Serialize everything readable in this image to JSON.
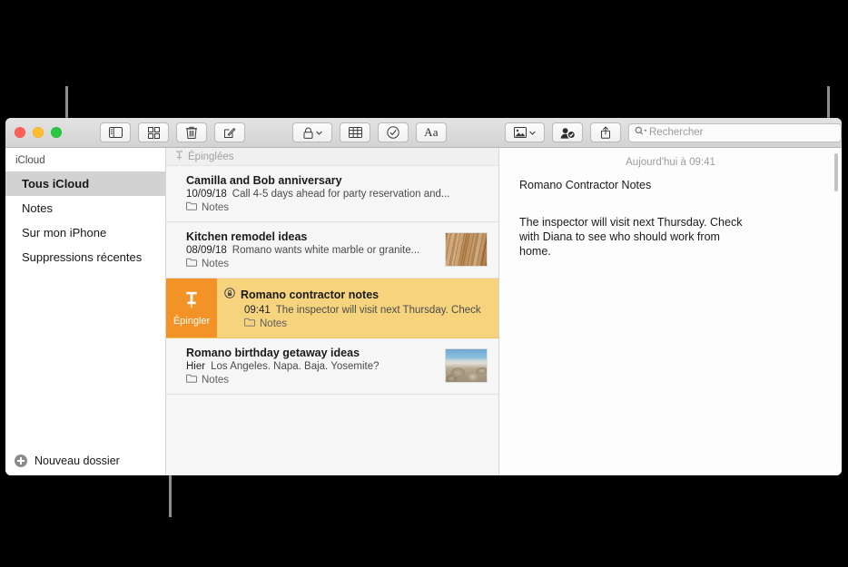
{
  "window": {
    "traffic_lights": [
      "close",
      "minimize",
      "zoom"
    ],
    "colors": {
      "pin_accent": "#f29227",
      "pinned_row": "#f6d47e",
      "selection": "#d2d2d2",
      "close": "#ff5f57",
      "minimize": "#ffbd2e",
      "zoom": "#28c840"
    }
  },
  "toolbar": {
    "left_buttons": [
      {
        "name": "sidebar-toggle",
        "icon": "sidebar-icon",
        "label": ""
      },
      {
        "name": "gallery-view",
        "icon": "grid-icon",
        "label": ""
      },
      {
        "name": "delete-note",
        "icon": "trash-icon",
        "label": ""
      },
      {
        "name": "new-note",
        "icon": "compose-icon",
        "label": ""
      }
    ],
    "center_buttons": [
      {
        "name": "lock-note",
        "icon": "lock-icon",
        "label": "",
        "has_menu": true
      },
      {
        "name": "add-table",
        "icon": "table-icon",
        "label": ""
      },
      {
        "name": "checklist",
        "icon": "checkmark-circle-icon",
        "label": ""
      },
      {
        "name": "format-text",
        "icon": "aa-icon",
        "label": "Aa"
      }
    ],
    "right_buttons": [
      {
        "name": "add-media",
        "icon": "photo-icon",
        "label": "",
        "has_menu": true
      },
      {
        "name": "add-collaborator",
        "icon": "person-add-icon",
        "label": ""
      },
      {
        "name": "share-note",
        "icon": "share-icon",
        "label": ""
      }
    ],
    "search": {
      "placeholder": "Rechercher",
      "value": "",
      "icon": "search-icon"
    }
  },
  "sidebar": {
    "header": "iCloud",
    "items": [
      {
        "label": "Tous iCloud",
        "selected": true
      },
      {
        "label": "Notes",
        "selected": false
      },
      {
        "label": "Sur mon iPhone",
        "selected": false
      },
      {
        "label": "Suppressions récentes",
        "selected": false
      }
    ],
    "footer": {
      "label": "Nouveau dossier",
      "icon": "plus-circle-icon"
    }
  },
  "note_list": {
    "section_header": {
      "label": "Épinglées",
      "icon": "pin-icon"
    },
    "notes": [
      {
        "title": "Camilla and Bob anniversary",
        "date": "10/09/18",
        "snippet": "Call 4-5 days ahead for party reservation and...",
        "folder": "Notes",
        "thumbnail": null,
        "pinned": false,
        "selected": false,
        "locked": false
      },
      {
        "title": "Kitchen remodel ideas",
        "date": "08/09/18",
        "snippet": "Romano wants white marble or granite...",
        "folder": "Notes",
        "thumbnail": "wood-floor",
        "pinned": false,
        "selected": false,
        "locked": false
      },
      {
        "title": "Romano contractor notes",
        "date": "09:41",
        "snippet": "The inspector will visit next Thursday. Check",
        "folder": "Notes",
        "thumbnail": null,
        "pinned": true,
        "selected": true,
        "locked": true,
        "pin_action_label": "Épingler"
      },
      {
        "title": "Romano birthday getaway ideas",
        "date": "Hier",
        "snippet": "Los Angeles. Napa. Baja. Yosemite?",
        "folder": "Notes",
        "thumbnail": "beach-rocks",
        "pinned": false,
        "selected": false,
        "locked": false
      }
    ]
  },
  "detail": {
    "timestamp": "Aujourd'hui à 09:41",
    "title": "Romano Contractor Notes",
    "body": "The inspector will visit next Thursday. Check with Diana to see who should work from home."
  }
}
